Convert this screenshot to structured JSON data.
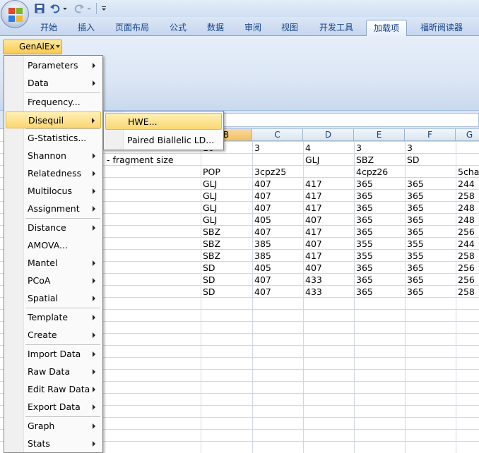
{
  "ribbon_tabs": [
    "开始",
    "插入",
    "页面布局",
    "公式",
    "数据",
    "审阅",
    "视图",
    "开发工具",
    "加载项",
    "福昕阅读器"
  ],
  "active_tab": "加载项",
  "addin_button": "GenAlEx",
  "columns": [
    "B",
    "C",
    "D",
    "E",
    "F",
    "G"
  ],
  "selected_column": "B",
  "sheet_rows": [
    [
      "10",
      "3",
      "4",
      "3",
      "3",
      ""
    ],
    [
      "",
      "",
      "GLJ",
      "SBZ",
      "SD",
      ""
    ],
    [
      "POP",
      "3cpz25",
      "",
      "4cpz26",
      "",
      "5cha"
    ],
    [
      "GLJ",
      "407",
      "417",
      "365",
      "365",
      "244"
    ],
    [
      "GLJ",
      "407",
      "417",
      "365",
      "365",
      "258"
    ],
    [
      "GLJ",
      "407",
      "417",
      "365",
      "365",
      "248"
    ],
    [
      "GLJ",
      "405",
      "407",
      "365",
      "365",
      "248"
    ],
    [
      "SBZ",
      "407",
      "417",
      "365",
      "365",
      "256"
    ],
    [
      "SBZ",
      "385",
      "407",
      "355",
      "355",
      "244"
    ],
    [
      "SBZ",
      "385",
      "417",
      "355",
      "355",
      "258"
    ],
    [
      "SD",
      "405",
      "407",
      "365",
      "365",
      "256"
    ],
    [
      "SD",
      "407",
      "433",
      "365",
      "365",
      "256"
    ],
    [
      "SD",
      "407",
      "433",
      "365",
      "365",
      "258"
    ]
  ],
  "row2_label": "- fragment size",
  "menu_items": [
    {
      "label": "Parameters",
      "sub": true
    },
    {
      "label": "Data",
      "sub": true
    },
    {
      "label": "Frequency...",
      "sub": false
    },
    {
      "label": "Disequil",
      "sub": true
    },
    {
      "label": "G-Statistics...",
      "sub": false
    },
    {
      "label": "Shannon",
      "sub": true
    },
    {
      "label": "Relatedness",
      "sub": true
    },
    {
      "label": "Multilocus",
      "sub": true
    },
    {
      "label": "Assignment",
      "sub": true
    },
    {
      "label": "Distance",
      "sub": true
    },
    {
      "label": "AMOVA...",
      "sub": false
    },
    {
      "label": "Mantel",
      "sub": true
    },
    {
      "label": "PCoA",
      "sub": true
    },
    {
      "label": "Spatial",
      "sub": true
    },
    {
      "label": "Template",
      "sub": true
    },
    {
      "label": "Create",
      "sub": true
    },
    {
      "label": "Import Data",
      "sub": true
    },
    {
      "label": "Raw Data",
      "sub": true
    },
    {
      "label": "Edit Raw Data",
      "sub": true
    },
    {
      "label": "Export Data",
      "sub": true
    },
    {
      "label": "Graph",
      "sub": true
    },
    {
      "label": "Stats",
      "sub": true
    }
  ],
  "submenu_items": [
    "HWE...",
    "Paired Biallelic LD..."
  ],
  "colors": {
    "accent": "#15428b",
    "highlight": "#fbd672",
    "ribbon": "#dbe6f5"
  }
}
